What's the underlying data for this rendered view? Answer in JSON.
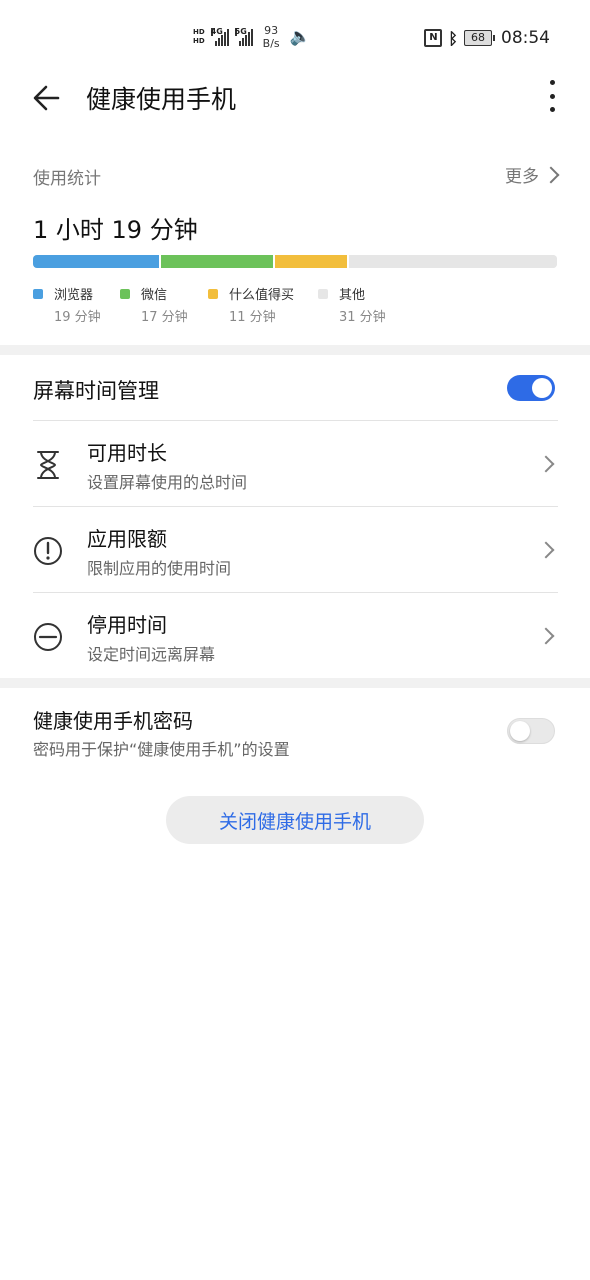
{
  "status_bar": {
    "hd_top": "HD",
    "hd_bottom": "HD",
    "sim1_label": "4G",
    "sim2_label": "5G",
    "speed_value": "93",
    "speed_unit": "B/s",
    "nfc": "N",
    "battery_level": "68",
    "time": "08:54"
  },
  "app_bar": {
    "title": "健康使用手机"
  },
  "usage_stats": {
    "header": "使用统计",
    "more_label": "更多",
    "total_time": "1 小时 19 分钟",
    "apps": [
      {
        "name": "浏览器",
        "time": "19 分钟",
        "minutes": 19,
        "color": "#4a9fe0"
      },
      {
        "name": "微信",
        "time": "17 分钟",
        "minutes": 17,
        "color": "#6cc25a"
      },
      {
        "name": "什么值得买",
        "time": "11 分钟",
        "minutes": 11,
        "color": "#f2be3c"
      },
      {
        "name": "其他",
        "time": "31 分钟",
        "minutes": 31,
        "color": "#e6e6e6"
      }
    ]
  },
  "screen_time": {
    "title": "屏幕时间管理",
    "enabled": true,
    "items": [
      {
        "title": "可用时长",
        "subtitle": "设置屏幕使用的总时间",
        "icon": "hourglass-icon"
      },
      {
        "title": "应用限额",
        "subtitle": "限制应用的使用时间",
        "icon": "exclamation-circle-icon"
      },
      {
        "title": "停用时间",
        "subtitle": "设定时间远离屏幕",
        "icon": "minus-circle-icon"
      }
    ]
  },
  "password": {
    "title": "健康使用手机密码",
    "subtitle": "密码用于保护“健康使用手机”的设置",
    "enabled": false
  },
  "close_button": {
    "label": "关闭健康使用手机"
  },
  "colors": {
    "accent": "#2e6be6"
  }
}
